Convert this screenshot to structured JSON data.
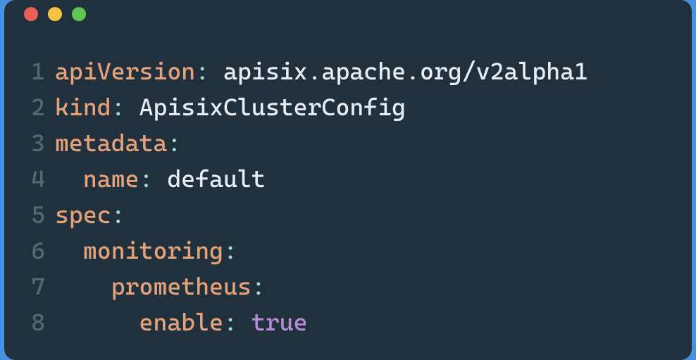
{
  "window": {
    "traffic": [
      "red",
      "yellow",
      "green"
    ]
  },
  "code": {
    "lines": [
      {
        "num": "1",
        "tokens": [
          {
            "cls": "tok-key",
            "text": "apiVersion"
          },
          {
            "cls": "tok-teal",
            "text": ": "
          },
          {
            "cls": "tok-plain",
            "text": "apisix.apache.org/v2alpha1"
          }
        ]
      },
      {
        "num": "2",
        "tokens": [
          {
            "cls": "tok-key",
            "text": "kind"
          },
          {
            "cls": "tok-teal",
            "text": ": "
          },
          {
            "cls": "tok-plain",
            "text": "ApisixClusterConfig"
          }
        ]
      },
      {
        "num": "3",
        "tokens": [
          {
            "cls": "tok-key",
            "text": "metadata"
          },
          {
            "cls": "tok-teal",
            "text": ":"
          }
        ]
      },
      {
        "num": "4",
        "tokens": [
          {
            "cls": "tok-plain",
            "text": "  "
          },
          {
            "cls": "tok-key",
            "text": "name"
          },
          {
            "cls": "tok-teal",
            "text": ": "
          },
          {
            "cls": "tok-plain",
            "text": "default"
          }
        ]
      },
      {
        "num": "5",
        "tokens": [
          {
            "cls": "tok-key",
            "text": "spec"
          },
          {
            "cls": "tok-teal",
            "text": ":"
          }
        ]
      },
      {
        "num": "6",
        "tokens": [
          {
            "cls": "tok-plain",
            "text": "  "
          },
          {
            "cls": "tok-key",
            "text": "monitoring"
          },
          {
            "cls": "tok-teal",
            "text": ":"
          }
        ]
      },
      {
        "num": "7",
        "tokens": [
          {
            "cls": "tok-plain",
            "text": "    "
          },
          {
            "cls": "tok-key",
            "text": "prometheus"
          },
          {
            "cls": "tok-teal",
            "text": ":"
          }
        ]
      },
      {
        "num": "8",
        "tokens": [
          {
            "cls": "tok-plain",
            "text": "      "
          },
          {
            "cls": "tok-key",
            "text": "enable"
          },
          {
            "cls": "tok-teal",
            "text": ": "
          },
          {
            "cls": "tok-bool",
            "text": "true"
          }
        ]
      }
    ]
  }
}
